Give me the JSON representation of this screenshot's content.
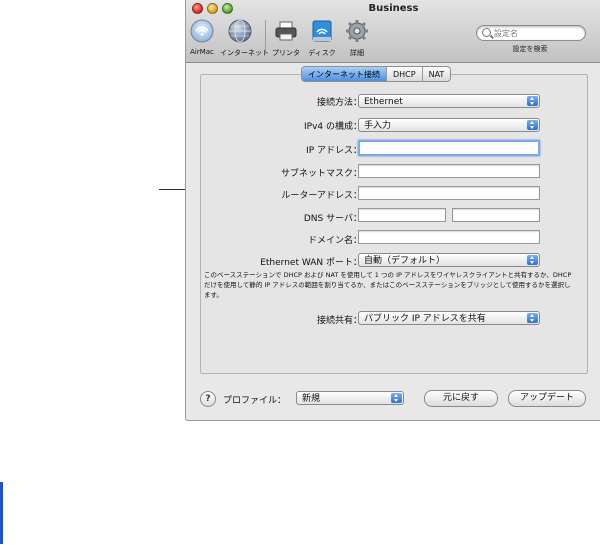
{
  "window": {
    "title": "Business"
  },
  "toolbar": {
    "items": [
      {
        "label": "AirMac",
        "icon": "airmac-icon"
      },
      {
        "label": "インターネット",
        "icon": "globe-icon"
      },
      {
        "label": "プリンタ",
        "icon": "printer-icon"
      },
      {
        "label": "ディスク",
        "icon": "disk-icon"
      },
      {
        "label": "詳細",
        "icon": "gear-icon"
      }
    ],
    "search": {
      "placeholder": "設定名",
      "caption": "設定を検索"
    }
  },
  "tabs": [
    {
      "label": "インターネット接続",
      "active": true
    },
    {
      "label": "DHCP",
      "active": false
    },
    {
      "label": "NAT",
      "active": false
    }
  ],
  "form": {
    "connection_method": {
      "label": "接続方法：",
      "value": "Ethernet"
    },
    "ipv4_config": {
      "label": "IPv4 の構成：",
      "value": "手入力"
    },
    "ip_address": {
      "label": "IP アドレス：",
      "value": ""
    },
    "subnet_mask": {
      "label": "サブネットマスク：",
      "value": ""
    },
    "router_address": {
      "label": "ルーターアドレス：",
      "value": ""
    },
    "dns_server": {
      "label": "DNS サーバ：",
      "value1": "",
      "value2": ""
    },
    "domain_name": {
      "label": "ドメイン名：",
      "value": ""
    },
    "wan_port": {
      "label": "Ethernet WAN ポート：",
      "value": "自動（デフォルト）"
    },
    "description": "このベースステーションで DHCP および NAT を使用して 1 つの IP アドレスをワイヤレスクライアントと共有するか、DHCP だけを使用して静的 IP アドレスの範囲を割り当てるか、またはこのベースステーションをブリッジとして使用するかを選択します。",
    "connection_sharing": {
      "label": "接続共有：",
      "value": "パブリック IP アドレスを共有"
    }
  },
  "bottom": {
    "help_glyph": "?",
    "profile_label": "プロファイル：",
    "profile_value": "新規",
    "revert_label": "元に戻す",
    "update_label": "アップデート"
  },
  "colors": {
    "accent": "#4d8fe3",
    "left_marker": "#1a4fd8"
  }
}
